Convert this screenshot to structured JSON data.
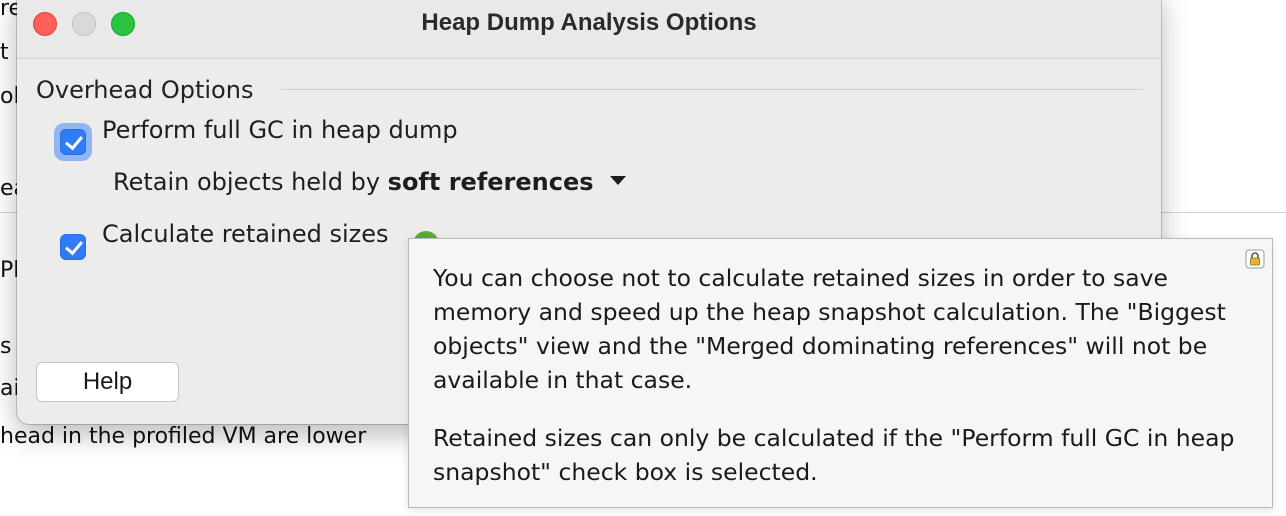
{
  "background": {
    "lines": [
      "re",
      "t",
      "ol",
      "ea",
      "Pl",
      "s",
      "ail",
      "head in the profiled VM are lower"
    ]
  },
  "dialog": {
    "title": "Heap Dump Analysis Options",
    "section_label": "Overhead Options",
    "options": {
      "full_gc": {
        "label": "Perform full GC in heap dump",
        "checked": true
      },
      "retain_prefix": "Retain objects held by ",
      "retain_value": "soft references",
      "retained_sizes": {
        "label": "Calculate retained sizes",
        "checked": true
      }
    },
    "help_button": "Help"
  },
  "tooltip": {
    "paragraph1": "You can choose not to calculate retained sizes in order to save memory and speed up the heap snapshot calculation. The \"Biggest objects\" view and the \"Merged dominating references\" will not be available in that case.",
    "paragraph2": "Retained sizes can only be calculated if the \"Perform full GC in heap snapshot\" check box is selected."
  },
  "colors": {
    "accent": "#2f7cf6",
    "close": "#fe5f57",
    "maximize": "#29c440",
    "help_icon": "#5aa93a"
  },
  "icons": [
    "close-icon",
    "minimize-icon",
    "maximize-icon",
    "checkmark-icon",
    "chevron-down-icon",
    "help-icon",
    "lock-icon"
  ]
}
